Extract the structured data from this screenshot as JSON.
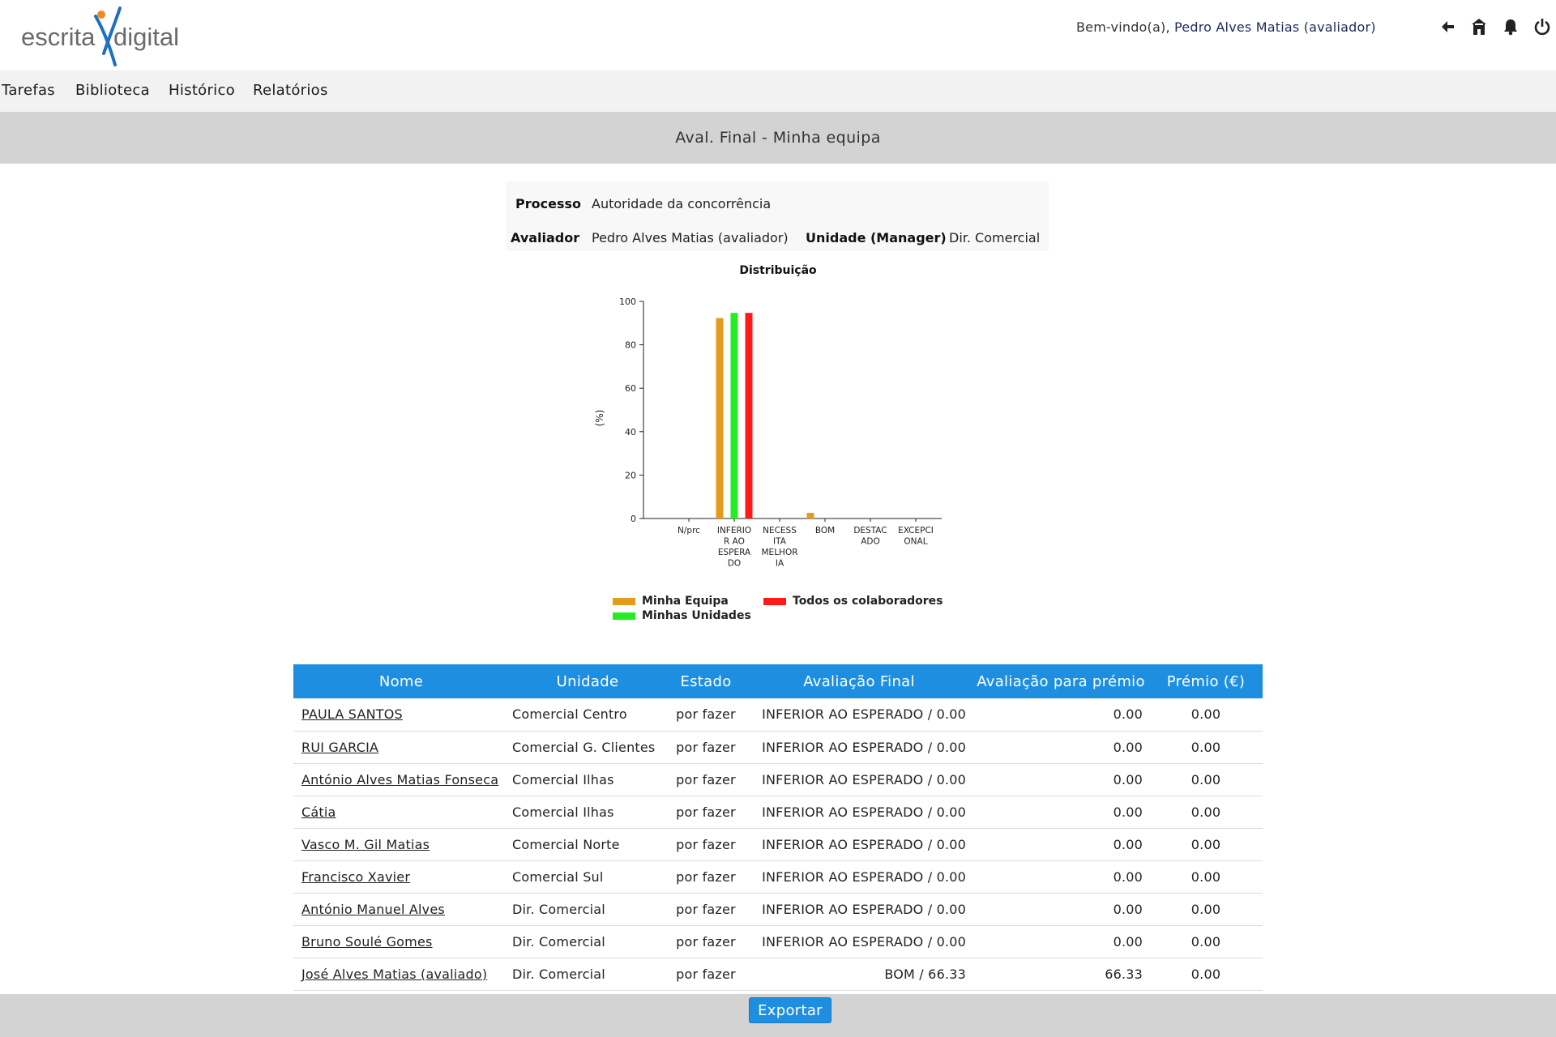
{
  "header": {
    "logo_text_left": "escrita",
    "logo_text_right": "digital",
    "welcome_prefix": "Bem-vindo(a),",
    "welcome_user": "Pedro Alves Matias (avaliador)",
    "icons": [
      "back-arrow-icon",
      "home-icon",
      "bell-icon",
      "power-icon"
    ]
  },
  "nav": {
    "items": [
      "Tarefas",
      "Biblioteca",
      "Histórico",
      "Relatórios"
    ]
  },
  "page": {
    "title": "Aval. Final - Minha equipa"
  },
  "info": {
    "processo_label": "Processo",
    "processo_value": "Autoridade da concorrência",
    "avaliador_label": "Avaliador",
    "avaliador_value": "Pedro Alves Matias (avaliador)",
    "unidade_label": "Unidade (Manager)",
    "unidade_value": "Dir. Comercial"
  },
  "chart_data": {
    "type": "bar",
    "title": "Distribuição",
    "ylabel": "(%)",
    "xlabel": "",
    "ylim": [
      0,
      100
    ],
    "yticks": [
      0,
      20,
      40,
      60,
      80,
      100
    ],
    "categories": [
      "N/prc",
      "INFERIOR AO ESPERADO",
      "NECESSITA MELHORIA",
      "BOM",
      "DESTACADO",
      "EXCEPCIONAL"
    ],
    "category_label_lines": [
      [
        "N/prc"
      ],
      [
        "INFERIO",
        "R AO",
        "ESPERA",
        "DO"
      ],
      [
        "NECESS",
        "ITA",
        "MELHOR",
        "IA"
      ],
      [
        "BOM"
      ],
      [
        "DESTAC",
        "ADO"
      ],
      [
        "EXCEPCI",
        "ONAL"
      ]
    ],
    "series": [
      {
        "name": "Minha Equipa",
        "color": "#e39a1e",
        "values": [
          0,
          92.3,
          0,
          2.6,
          0,
          0
        ]
      },
      {
        "name": "Minhas Unidades",
        "color": "#22ee22",
        "values": [
          0,
          94.7,
          0,
          0,
          0,
          0
        ]
      },
      {
        "name": "Todos os colaboradores",
        "color": "#ff1a1a",
        "values": [
          0,
          94.7,
          0,
          0,
          0,
          0
        ]
      }
    ],
    "legend_position": "bottom",
    "grid": false
  },
  "table": {
    "headers": [
      "Nome",
      "Unidade",
      "Estado",
      "Avaliação Final",
      "Avaliação para prémio",
      "Prémio (€)"
    ],
    "rows": [
      {
        "nome": "PAULA SANTOS",
        "unidade": "Comercial Centro",
        "estado": "por fazer",
        "avaliacao": "INFERIOR AO ESPERADO / 0.00",
        "av_premio": "0.00",
        "premio": "0.00"
      },
      {
        "nome": "RUI GARCIA",
        "unidade": "Comercial G. Clientes",
        "estado": "por fazer",
        "avaliacao": "INFERIOR AO ESPERADO / 0.00",
        "av_premio": "0.00",
        "premio": "0.00"
      },
      {
        "nome": "António Alves Matias Fonseca",
        "unidade": "Comercial Ilhas",
        "estado": "por fazer",
        "avaliacao": "INFERIOR AO ESPERADO / 0.00",
        "av_premio": "0.00",
        "premio": "0.00"
      },
      {
        "nome": "Cátia",
        "unidade": "Comercial Ilhas",
        "estado": "por fazer",
        "avaliacao": "INFERIOR AO ESPERADO / 0.00",
        "av_premio": "0.00",
        "premio": "0.00"
      },
      {
        "nome": "Vasco M. Gil Matias",
        "unidade": "Comercial Norte",
        "estado": "por fazer",
        "avaliacao": "INFERIOR AO ESPERADO / 0.00",
        "av_premio": "0.00",
        "premio": "0.00"
      },
      {
        "nome": "Francisco Xavier",
        "unidade": "Comercial Sul",
        "estado": "por fazer",
        "avaliacao": "INFERIOR AO ESPERADO / 0.00",
        "av_premio": "0.00",
        "premio": "0.00"
      },
      {
        "nome": "António Manuel Alves",
        "unidade": "Dir. Comercial",
        "estado": "por fazer",
        "avaliacao": "INFERIOR AO ESPERADO / 0.00",
        "av_premio": "0.00",
        "premio": "0.00"
      },
      {
        "nome": "Bruno Soulé Gomes",
        "unidade": "Dir. Comercial",
        "estado": "por fazer",
        "avaliacao": "INFERIOR AO ESPERADO / 0.00",
        "av_premio": "0.00",
        "premio": "0.00"
      },
      {
        "nome": "José Alves Matias (avaliado)",
        "unidade": "Dir. Comercial",
        "estado": "por fazer",
        "avaliacao": "BOM / 66.33",
        "av_premio": "66.33",
        "premio": "0.00"
      }
    ]
  },
  "footer": {
    "export_label": "Exportar"
  },
  "colors": {
    "accent": "#1e8fe0",
    "titlebar": "#d3d3d3",
    "nav_bg": "#f2f2f2",
    "logo_orange": "#f08a1c",
    "logo_blue": "#1f6fc2"
  }
}
